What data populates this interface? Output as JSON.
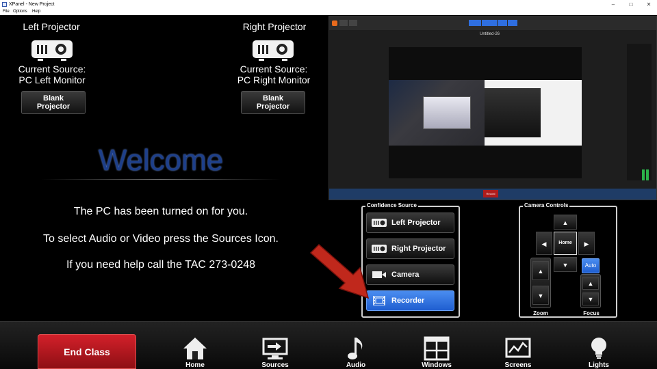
{
  "window": {
    "title": "XPanel - New Project",
    "menu": [
      "File",
      "Options",
      "Help"
    ]
  },
  "left_projector": {
    "title": "Left Projector",
    "source_label": "Current Source:",
    "source_value": "PC Left Monitor",
    "blank_label": "Blank\nProjector"
  },
  "right_projector": {
    "title": "Right Projector",
    "source_label": "Current Source:",
    "source_value": "PC Right Monitor",
    "blank_label": "Blank\nProjector"
  },
  "welcome": {
    "heading": "Welcome",
    "lines": [
      "The PC has been turned on for you.",
      "To select Audio or Video press the Sources Icon.",
      "If you need help call the TAC 273-0248"
    ]
  },
  "preview": {
    "doc_title": "Untitled-26",
    "record_label": "Record"
  },
  "confidence_source": {
    "title": "Confidence Source",
    "items": [
      {
        "label": "Left Projector",
        "icon": "projector-icon",
        "active": false
      },
      {
        "label": "Right Projector",
        "icon": "projector-icon",
        "active": false
      },
      {
        "label": "Camera",
        "icon": "camera-icon",
        "active": false
      },
      {
        "label": "Recorder",
        "icon": "film-icon",
        "active": true
      }
    ]
  },
  "camera_controls": {
    "title": "Camera Controls",
    "home_label": "Home",
    "zoom_label": "Zoom",
    "focus_label": "Focus",
    "auto_label": "Auto"
  },
  "nav": {
    "end_class": "End Class",
    "items": [
      {
        "label": "Home",
        "icon": "home-icon"
      },
      {
        "label": "Sources",
        "icon": "sources-icon"
      },
      {
        "label": "Audio",
        "icon": "music-note-icon"
      },
      {
        "label": "Windows",
        "icon": "windows-icon"
      },
      {
        "label": "Screens",
        "icon": "screens-icon"
      },
      {
        "label": "Lights",
        "icon": "lightbulb-icon"
      }
    ]
  },
  "colors": {
    "accent_blue": "#2f6fe0",
    "end_class_red": "#c01820",
    "welcome_blue": "#1d3f8a"
  }
}
